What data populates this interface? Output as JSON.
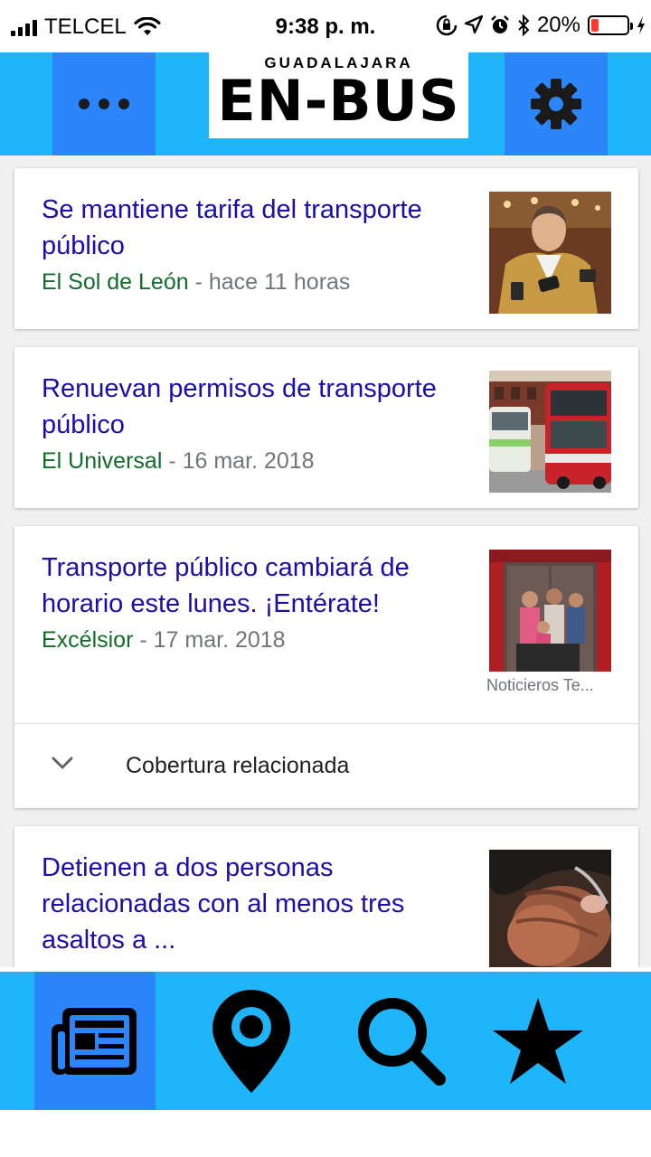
{
  "status_bar": {
    "carrier": "TELCEL",
    "time": "9:38 p. m.",
    "battery_percent": "20%",
    "battery_level": 0.2,
    "icons": [
      "signal-icon",
      "wifi-icon",
      "rotation-lock-icon",
      "location-icon",
      "alarm-icon",
      "bluetooth-icon",
      "battery-icon",
      "charging-icon"
    ]
  },
  "header": {
    "logo_city": "GUADALAJARA",
    "logo_name": "EN-BUS",
    "menu_icon": "ellipsis-icon",
    "settings_icon": "gear-icon"
  },
  "feed": {
    "items": [
      {
        "title": "Se mantiene tarifa del transporte público",
        "source": "El Sol de León",
        "separator": " - ",
        "date": "hace 11 horas"
      },
      {
        "title": "Renuevan permisos de transporte público",
        "source": "El Universal",
        "separator": " - ",
        "date": "16 mar. 2018"
      },
      {
        "title": "Transporte público cambiará de horario este lunes. ¡Entérate!",
        "source": "Excélsior",
        "separator": " - ",
        "date": "17 mar. 2018",
        "image_credit": "Noticieros Te...",
        "related_label": "Cobertura relacionada"
      },
      {
        "title": "Detienen a dos personas relacionadas con al menos tres asaltos a ..."
      }
    ]
  },
  "bottom_nav": {
    "items": [
      {
        "icon": "newspaper-icon",
        "active": true
      },
      {
        "icon": "map-pin-icon",
        "active": false
      },
      {
        "icon": "search-icon",
        "active": false
      },
      {
        "icon": "star-icon",
        "active": false
      }
    ]
  },
  "colors": {
    "header_bg": "#1fb5fb",
    "button_bg": "#2c86fb",
    "headline": "#1a0dab",
    "source": "#116c2a",
    "meta": "#70757a"
  }
}
